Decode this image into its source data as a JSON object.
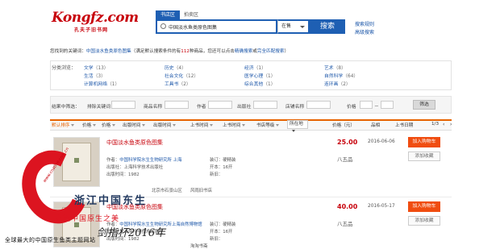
{
  "header": {
    "logo_text": "Kongfz.com",
    "logo_sub": "孔夫子旧书网",
    "tabs": [
      "书店区",
      "拍卖区"
    ],
    "search_value": "中国淡水鱼类原色图集",
    "search_scope": "在售",
    "search_button": "搜索",
    "links": [
      "搜索规则",
      "高级搜索"
    ]
  },
  "result_line": {
    "prefix": "您找到的关键词：",
    "keyword": "中国淡水鱼类原色图集",
    "mid": "（满足默认搜索条件的有",
    "count": "112",
    "suffix": "种商品，您还可以点击",
    "link1": "精确搜索",
    "or": "或",
    "link2": "完全匹配搜索",
    "end": "）"
  },
  "categories": {
    "label": "分类浏览：",
    "items": [
      {
        "name": "文学",
        "count": "（13）"
      },
      {
        "name": "历史",
        "count": "（4）"
      },
      {
        "name": "经济",
        "count": "（1）"
      },
      {
        "name": "艺术",
        "count": "（8）"
      },
      {
        "name": "生活",
        "count": "（3）"
      },
      {
        "name": "社会文化",
        "count": "（12）"
      },
      {
        "name": "医学心理",
        "count": "（1）"
      },
      {
        "name": "自然科学",
        "count": "（64）"
      },
      {
        "name": "计算机网络",
        "count": "（1）"
      },
      {
        "name": "工具书",
        "count": "（2）"
      },
      {
        "name": "综合其他",
        "count": "（1）"
      },
      {
        "name": "连环画",
        "count": "（2）"
      }
    ]
  },
  "filter": {
    "label": "结果中筛选：",
    "fields": [
      "排除关键词",
      "商品名称",
      "作者",
      "出版社",
      "店铺名称"
    ],
    "price_label": "价格",
    "price_dash": "－",
    "button": "筛选"
  },
  "sort": {
    "items": [
      "默认排序",
      "价格",
      "价格",
      "出版时间",
      "出版时间",
      "上书时间",
      "上书时间",
      "书店等级"
    ],
    "select_value": "所在地",
    "right_labels": [
      "价格（元）",
      "品相",
      "上书日期"
    ],
    "pager": "1/3"
  },
  "listings": [
    {
      "title": "中国淡水鱼类原色图集",
      "price": "25.00",
      "date": "2016-06-06",
      "condition": "八五品",
      "buy": "加入购物车",
      "fav": "添加收藏",
      "author_label": "作者：",
      "author": "中国科学院水生生物研究所 上海",
      "binding_label": "装订：",
      "binding": "硬精装",
      "publisher_label": "出版社：",
      "publisher": "上海科学技术出版社",
      "size_label": "开本：",
      "size": "16开",
      "year_label": "出版时间：",
      "year": "1982",
      "newness_label": "新旧：",
      "shop_area": "北京市石景山区",
      "shop": "风雨旧书店"
    },
    {
      "title": "中国淡水鱼类原色图集",
      "price": "40.00",
      "date": "2016-05-17",
      "condition": "八五品",
      "buy": "加入购物车",
      "fav": "添加收藏",
      "author_label": "作者：",
      "author": "中国科学院水生生物研究所上海自然博物馆",
      "binding_label": "装订：",
      "binding": "硬精装",
      "publisher_label": "出版社：",
      "publisher": "上海科学技术出版社",
      "size_label": "开本：",
      "size": "16开",
      "year_label": "出版时间：",
      "year": "1982",
      "newness_label": "新旧：",
      "shop_area": "",
      "shop": "淘淘书斋"
    }
  ],
  "watermark": {
    "line1": "浙江中国东生",
    "line2": "守望中国原生之美",
    "line3": "剑指杯2016年",
    "line4": "全球最大的中国原生鱼类主题网站",
    "url": "www.cnative.com.cn"
  }
}
